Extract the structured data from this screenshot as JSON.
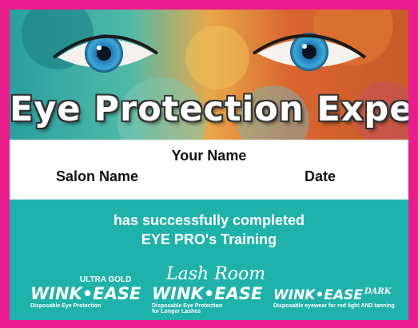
{
  "certificate": {
    "title": "Eye Protection Expert",
    "name_field": "Your Name",
    "salon_field": "Salon Name",
    "date_field": "Date",
    "completion_line1": "has successfully completed",
    "completion_line2": "EYE PRO's Training"
  },
  "logos": {
    "ultra_gold": {
      "tagline": "ULTRA GOLD",
      "brand": "WINK•EASE",
      "subtitle": "Disposable Eye Protection"
    },
    "lash_room": {
      "script": "Lash Room",
      "brand": "WINK•EASE",
      "subtitle_line1": "Disposable Eye Protection",
      "subtitle_line2": "for Longer Lashes"
    },
    "dark": {
      "brand": "WINK•EASE",
      "variant": "DARK",
      "subtitle": "Disposable eyewear for red light AND tanning"
    }
  },
  "colors": {
    "border": "#e91e8c",
    "teal": "#1fb2ab",
    "text": "#111111"
  }
}
